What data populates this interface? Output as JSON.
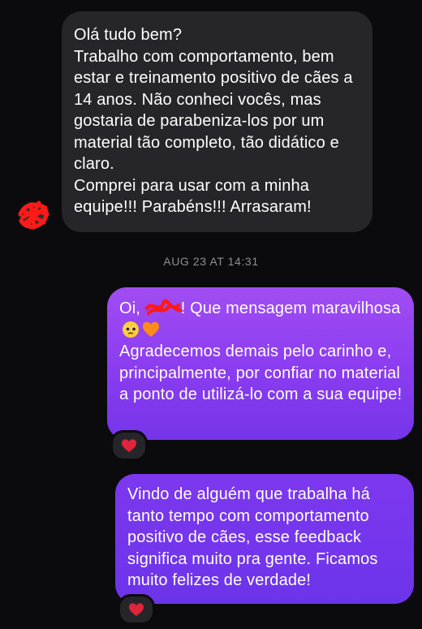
{
  "colors": {
    "background": "#0b0b0e",
    "incoming_bubble": "#26262a",
    "outgoing_bubble_top": "#a14df2",
    "outgoing_bubble_bottom": "#7635ea",
    "timestamp": "#8e8e93",
    "reaction_heart": "#e0243b",
    "redaction": "#ff1a1a"
  },
  "conversation": {
    "incoming_message": {
      "lines": [
        "Olá tudo bem?",
        "Trabalho com comportamento, bem estar e treinamento positivo de cães a 14 anos. Não conheci vocês, mas gostaria de parabeniza-los por um material tão completo, tão didático e claro.",
        "Comprei para usar com a minha equipe!!! Parabéns!!! Arrasaram!"
      ],
      "sender_avatar": "redacted-avatar"
    },
    "timestamp": "AUG 23 AT 14:31",
    "outgoing_message_1": {
      "greeting_prefix": "Oi,",
      "greeting_suffix": "! Que mensagem maravilhosa",
      "emojis": [
        "pleading-face-icon",
        "orange-heart-icon"
      ],
      "body": "Agradecemos demais pelo carinho e, principalmente, por confiar no material a ponto de utilizá-lo com a sua equipe!",
      "reaction": "red-heart-icon"
    },
    "outgoing_message_2": {
      "body": "Vindo de alguém que trabalha há tanto tempo com comportamento positivo de cães, esse feedback significa muito pra gente. Ficamos muito felizes de verdade!",
      "reaction": "red-heart-icon"
    }
  }
}
